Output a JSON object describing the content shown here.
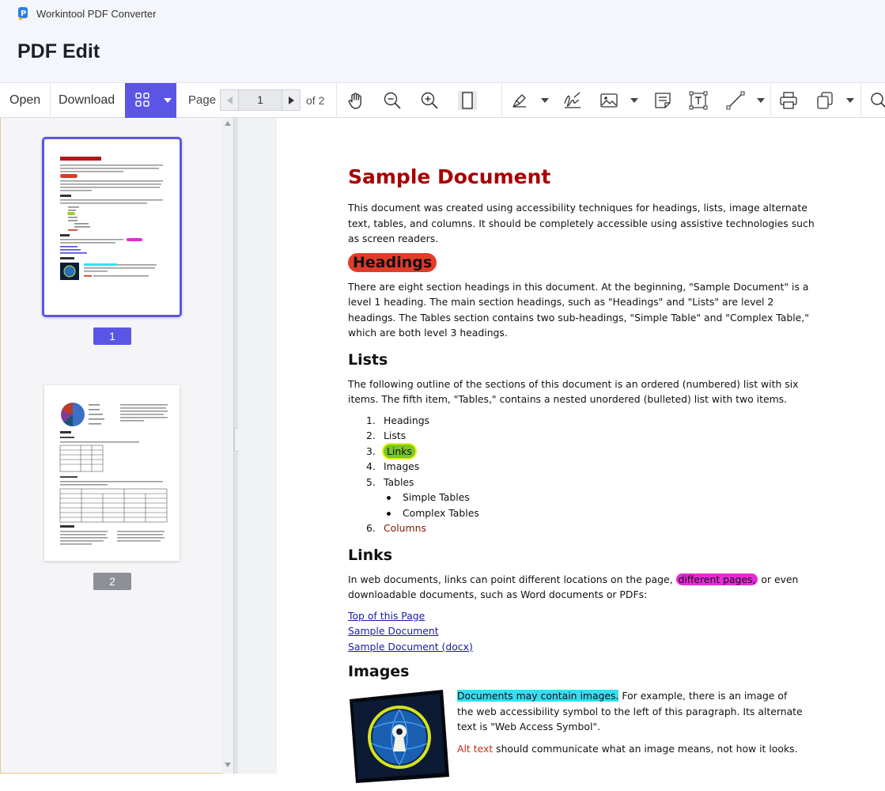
{
  "app": {
    "title": "Workintool PDF Converter",
    "heading": "PDF Edit"
  },
  "toolbar": {
    "open_label": "Open",
    "download_label": "Download",
    "page_label": "Page",
    "current_page": "1",
    "of_label": "of 2",
    "icons": [
      "hand-icon",
      "zoom-out-icon",
      "zoom-in-icon",
      "fit-page-icon",
      "highlight-icon",
      "signature-icon",
      "image-icon",
      "note-icon",
      "textbox-icon",
      "line-icon",
      "print-icon",
      "copy-icon",
      "search-icon"
    ]
  },
  "sidebar": {
    "pages": [
      {
        "label": "1"
      },
      {
        "label": "2"
      }
    ]
  },
  "document": {
    "title": "Sample Document",
    "intro": "This document was created using accessibility techniques for headings, lists, image alternate text, tables, and columns. It should be completely accessible using assistive technologies such as screen readers.",
    "headings": {
      "title": "Headings",
      "text": "There are eight section headings in this document. At the beginning, \"Sample Document\" is a level 1 heading. The main section headings, such as \"Headings\" and \"Lists\" are level 2 headings. The Tables section contains two sub-headings, \"Simple Table\" and \"Complex Table,\" which are both level 3 headings."
    },
    "lists": {
      "title": "Lists",
      "text": "The following outline of the sections of this document is an ordered (numbered) list with six items. The fifth item, \"Tables,\" contains a nested unordered (bulleted) list with two items.",
      "items": [
        {
          "num": "1.",
          "label": "Headings"
        },
        {
          "num": "2.",
          "label": "Lists"
        },
        {
          "num": "3.",
          "label": "Links"
        },
        {
          "num": "4.",
          "label": "Images"
        },
        {
          "num": "5.",
          "label": "Tables"
        }
      ],
      "sub_items": [
        "Simple Tables",
        "Complex Tables"
      ],
      "last_item": {
        "num": "6.",
        "label": "Columns"
      }
    },
    "links": {
      "title": "Links",
      "text_before": "In web documents, links can point different locations on the page,",
      "highlight": "different pages,",
      "text_after": " or even downloadable documents, such as Word documents or PDFs:",
      "items": [
        "Top of this Page",
        "Sample Document",
        "Sample Document (docx)"
      ]
    },
    "images": {
      "title": "Images",
      "highlight": "Documents may contain images.",
      "text": " For example, there is an image of the web accessibility symbol to the left of this paragraph. Its alternate text is \"Web Access Symbol\".",
      "alt_label": "Alt text",
      "alt_text": " should communicate what an image means, not how it looks."
    }
  },
  "colors": {
    "accent": "#5b55e6",
    "title_red": "#a80000",
    "highlight_red": "#e23b2a",
    "highlight_green": "#79c52a",
    "highlight_pink": "#e52ad8",
    "highlight_cyan": "#33e0f0",
    "link_blue": "#1a1aa8"
  }
}
